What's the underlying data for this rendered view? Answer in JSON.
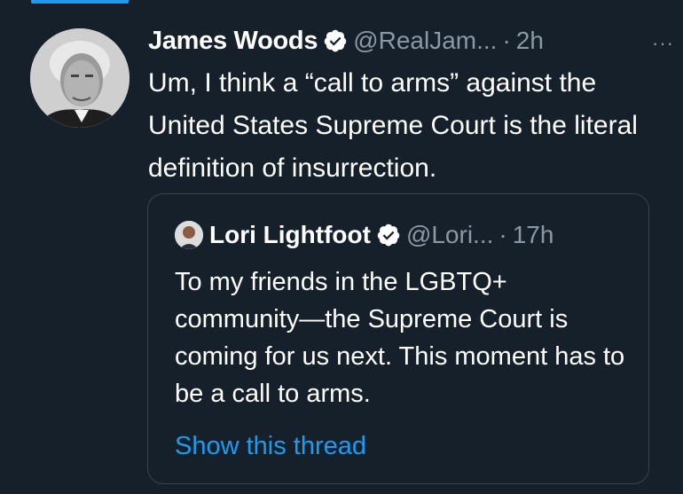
{
  "tweet": {
    "author_name": "James Woods",
    "handle": "@RealJam...",
    "separator": "·",
    "time": "2h",
    "more_label": "···",
    "text": "Um, I think a “call to arms” against the United States Supreme Court is the literal definition of insurrection."
  },
  "quoted_tweet": {
    "author_name": "Lori Lightfoot",
    "handle": "@Lori...",
    "separator": "·",
    "time": "17h",
    "text": "To my friends in the LGBTQ+ community—the Supreme Court is coming for us next. This moment has to be a call to arms.",
    "show_thread_label": "Show this thread"
  },
  "colors": {
    "background": "#15202b",
    "accent": "#1d9bf0",
    "secondary_text": "#8b98a5",
    "border": "#38444d"
  },
  "icons": [
    "verified-badge-icon",
    "more-options-icon"
  ]
}
